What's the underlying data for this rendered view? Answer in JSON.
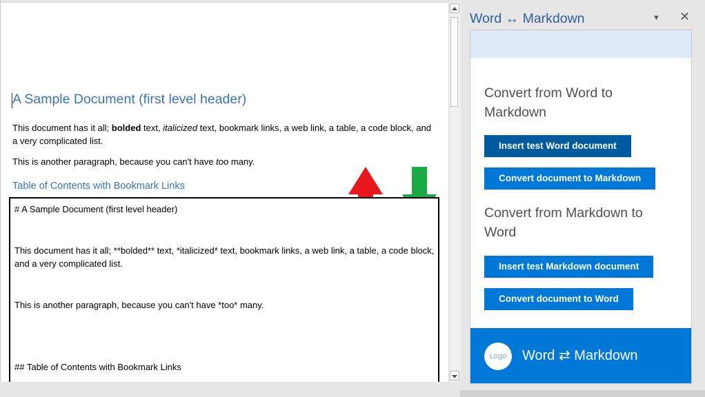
{
  "document": {
    "title": "A Sample Document (first level header)",
    "para1_a": "This document has it all; ",
    "para1_bold": "bolded",
    "para1_b": " text, ",
    "para1_italic": "italicized",
    "para1_c": " text, bookmark links, a web link, a table, a code block, and a very complicated list.",
    "para2_a": "This is another paragraph, because you can't have ",
    "para2_italic": "too",
    "para2_b": " many.",
    "heading2": "Table of Contents with Bookmark Links"
  },
  "markdown": {
    "line1": "# A Sample Document (first level header)",
    "line2": "This document has it all; **bolded** text, *italicized* text, bookmark links, a web link, a table, a code block, and a very complicated list.",
    "line3": "This is another paragraph, because you can't have *too* many.",
    "line4": "## Table of Contents with Bookmark Links"
  },
  "arrows": {
    "up_color": "#e8171e",
    "down_color": "#1aa943"
  },
  "pane": {
    "header_title": "Word ↔ Markdown",
    "section1_title": "Convert from Word to Markdown",
    "btn_insert_word": "Insert test Word document",
    "btn_convert_to_md": "Convert document to Markdown",
    "section2_title": "Convert from Markdown to Word",
    "btn_insert_md": "Insert test Markdown document",
    "btn_convert_to_word": "Convert document to Word",
    "footer_logo": "Logo",
    "footer_title": "Word ⇄ Markdown",
    "accent": "#0078d7"
  }
}
